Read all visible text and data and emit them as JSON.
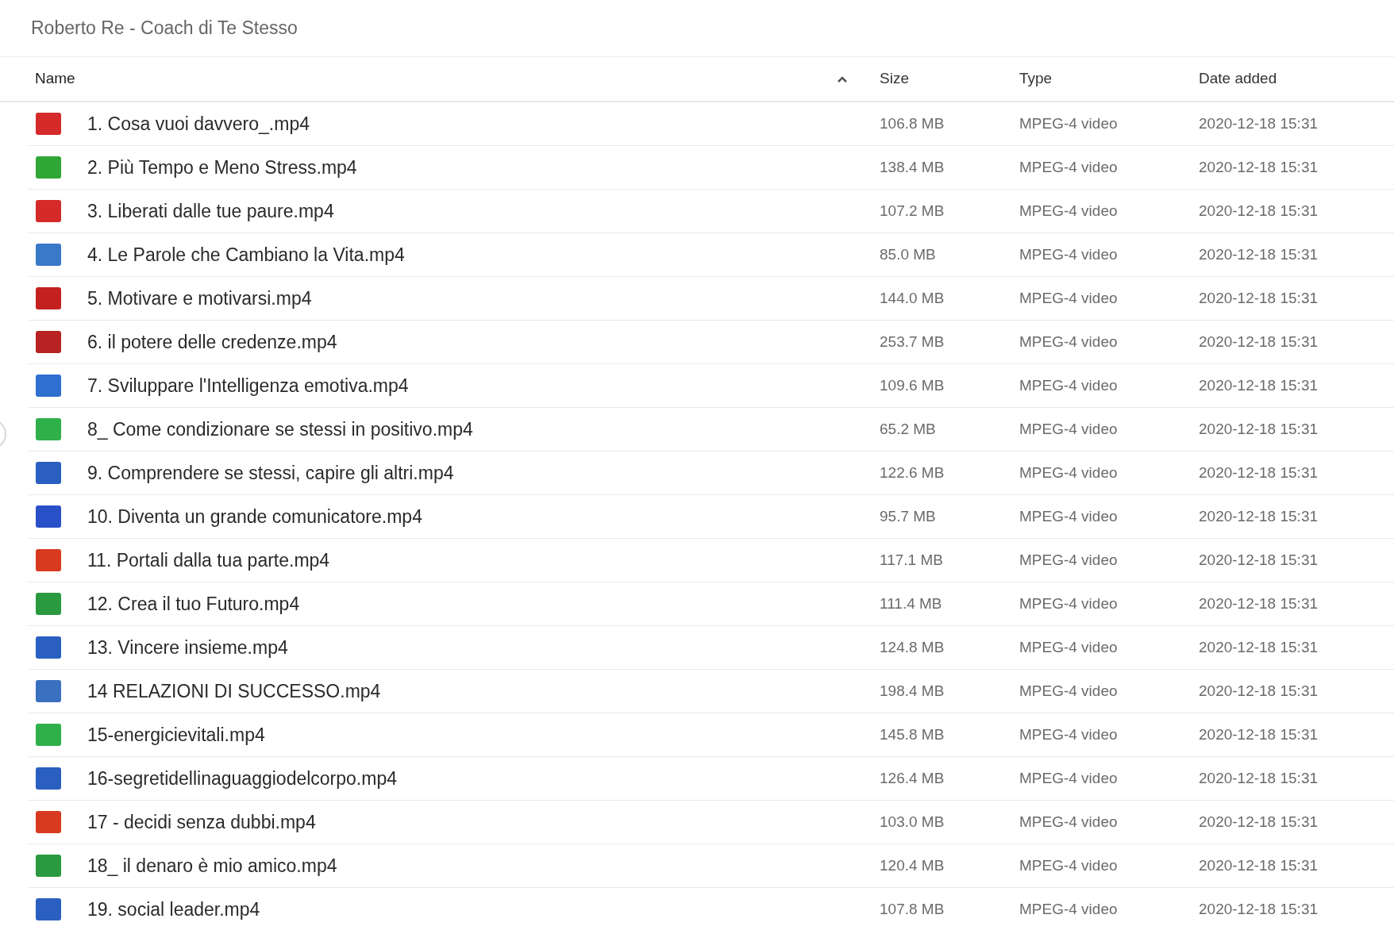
{
  "title": "Roberto Re - Coach di Te Stesso",
  "columns": [
    {
      "label": "Name",
      "sorted": true
    },
    {
      "label": "Size",
      "sorted": false
    },
    {
      "label": "Type",
      "sorted": false
    },
    {
      "label": "Date added",
      "sorted": false
    }
  ],
  "rows": [
    {
      "name": "1. Cosa vuoi davvero_.mp4",
      "size": "106.8 MB",
      "type": "MPEG-4 video",
      "date": "2020-12-18 15:31",
      "color": "#d42a2a"
    },
    {
      "name": "2. Più Tempo e Meno Stress.mp4",
      "size": "138.4 MB",
      "type": "MPEG-4 video",
      "date": "2020-12-18 15:31",
      "color": "#2fa636"
    },
    {
      "name": "3. Liberati dalle tue paure.mp4",
      "size": "107.2 MB",
      "type": "MPEG-4 video",
      "date": "2020-12-18 15:31",
      "color": "#d42a2a"
    },
    {
      "name": "4. Le Parole che Cambiano la Vita.mp4",
      "size": "85.0 MB",
      "type": "MPEG-4 video",
      "date": "2020-12-18 15:31",
      "color": "#3a78c8"
    },
    {
      "name": "5. Motivare e motivarsi.mp4",
      "size": "144.0 MB",
      "type": "MPEG-4 video",
      "date": "2020-12-18 15:31",
      "color": "#c42020"
    },
    {
      "name": "6. il potere delle credenze.mp4",
      "size": "253.7 MB",
      "type": "MPEG-4 video",
      "date": "2020-12-18 15:31",
      "color": "#b82222"
    },
    {
      "name": "7. Sviluppare l'Intelligenza emotiva.mp4",
      "size": "109.6 MB",
      "type": "MPEG-4 video",
      "date": "2020-12-18 15:31",
      "color": "#2e6fd0"
    },
    {
      "name": "8_ Come condizionare se stessi in positivo.mp4",
      "size": "65.2 MB",
      "type": "MPEG-4 video",
      "date": "2020-12-18 15:31",
      "color": "#2fb04a"
    },
    {
      "name": "9. Comprendere se stessi, capire gli altri.mp4",
      "size": "122.6 MB",
      "type": "MPEG-4 video",
      "date": "2020-12-18 15:31",
      "color": "#2a5fc0"
    },
    {
      "name": "10. Diventa un grande comunicatore.mp4",
      "size": "95.7 MB",
      "type": "MPEG-4 video",
      "date": "2020-12-18 15:31",
      "color": "#2a50c8"
    },
    {
      "name": "11. Portali dalla tua parte.mp4",
      "size": "117.1 MB",
      "type": "MPEG-4 video",
      "date": "2020-12-18 15:31",
      "color": "#d83a20"
    },
    {
      "name": "12. Crea il tuo Futuro.mp4",
      "size": "111.4 MB",
      "type": "MPEG-4 video",
      "date": "2020-12-18 15:31",
      "color": "#2a9a40"
    },
    {
      "name": "13. Vincere insieme.mp4",
      "size": "124.8 MB",
      "type": "MPEG-4 video",
      "date": "2020-12-18 15:31",
      "color": "#2a5fc0"
    },
    {
      "name": "14 RELAZIONI DI SUCCESSO.mp4",
      "size": "198.4 MB",
      "type": "MPEG-4 video",
      "date": "2020-12-18 15:31",
      "color": "#3a70c0"
    },
    {
      "name": "15-energicievitali.mp4",
      "size": "145.8 MB",
      "type": "MPEG-4 video",
      "date": "2020-12-18 15:31",
      "color": "#2fb04a"
    },
    {
      "name": "16-segretidellinaguaggiodelcorpo.mp4",
      "size": "126.4 MB",
      "type": "MPEG-4 video",
      "date": "2020-12-18 15:31",
      "color": "#2a5fc0"
    },
    {
      "name": "17 - decidi senza dubbi.mp4",
      "size": "103.0 MB",
      "type": "MPEG-4 video",
      "date": "2020-12-18 15:31",
      "color": "#d83a20"
    },
    {
      "name": "18_ il denaro è mio amico.mp4",
      "size": "120.4 MB",
      "type": "MPEG-4 video",
      "date": "2020-12-18 15:31",
      "color": "#2a9a40"
    },
    {
      "name": "19. social leader.mp4",
      "size": "107.8 MB",
      "type": "MPEG-4 video",
      "date": "2020-12-18 15:31",
      "color": "#2a5fc0"
    }
  ]
}
